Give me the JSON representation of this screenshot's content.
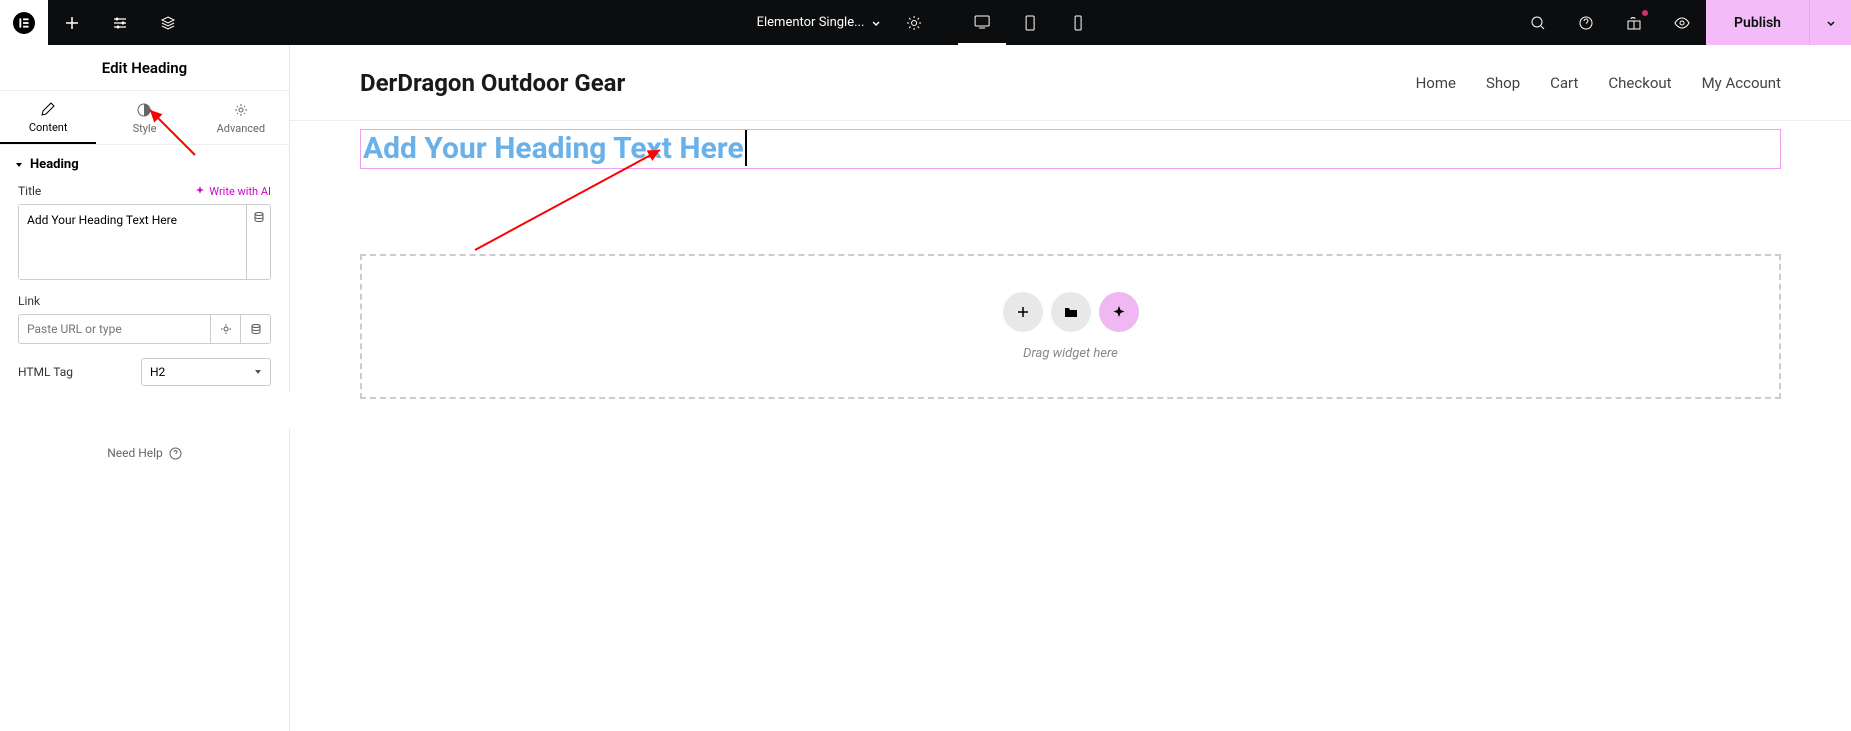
{
  "topbar": {
    "doc_title": "Elementor Single...",
    "publish_label": "Publish"
  },
  "sidebar": {
    "header": "Edit Heading",
    "tabs": {
      "content": "Content",
      "style": "Style",
      "advanced": "Advanced"
    },
    "section": "Heading",
    "title_label": "Title",
    "write_ai": "Write with AI",
    "title_value": "Add Your Heading Text Here",
    "link_label": "Link",
    "link_placeholder": "Paste URL or type",
    "html_tag_label": "HTML Tag",
    "html_tag_value": "H2",
    "need_help": "Need Help"
  },
  "site": {
    "title": "DerDragon Outdoor Gear",
    "nav": [
      "Home",
      "Shop",
      "Cart",
      "Checkout",
      "My Account"
    ]
  },
  "canvas": {
    "heading_text": "Add Your Heading Text Here",
    "drop_text": "Drag widget here"
  }
}
